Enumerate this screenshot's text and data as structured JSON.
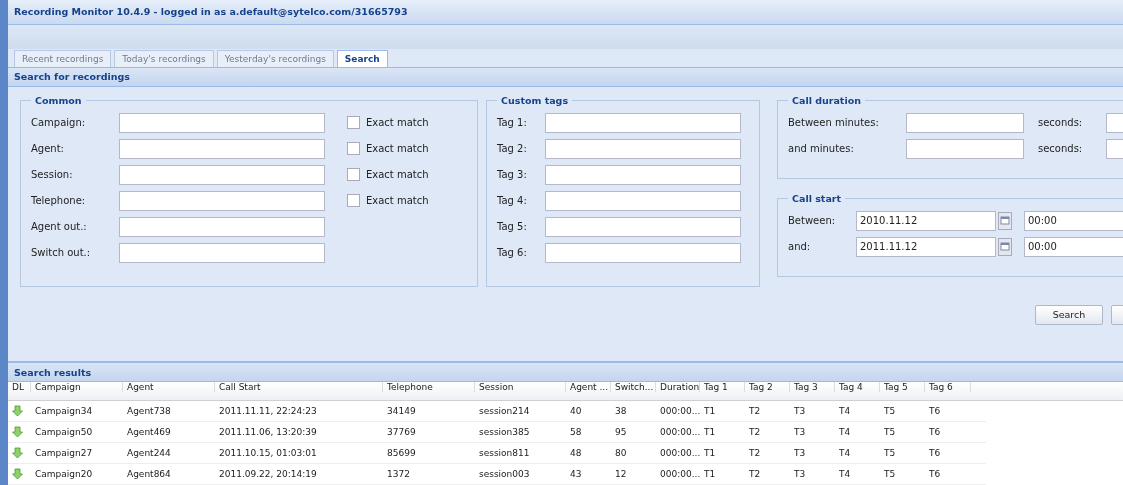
{
  "window": {
    "title": "Recording Monitor 10.4.9 - logged in as a.default@sytelco.com/31665793"
  },
  "tabs": [
    {
      "label": "Recent recordings",
      "selected": false
    },
    {
      "label": "Today's recordings",
      "selected": false
    },
    {
      "label": "Yesterday's recordings",
      "selected": false
    },
    {
      "label": "Search",
      "selected": true
    }
  ],
  "search_panel": {
    "title": "Search for recordings",
    "common": {
      "title": "Common",
      "fields": [
        {
          "label": "Campaign:",
          "exact_match": {
            "label": "Exact match",
            "checked": false
          }
        },
        {
          "label": "Agent:",
          "exact_match": {
            "label": "Exact match",
            "checked": false
          }
        },
        {
          "label": "Session:",
          "exact_match": {
            "label": "Exact match",
            "checked": false
          }
        },
        {
          "label": "Telephone:",
          "exact_match": {
            "label": "Exact match",
            "checked": false
          }
        },
        {
          "label": "Agent out.:"
        },
        {
          "label": "Switch out.:"
        }
      ]
    },
    "custom_tags": {
      "title": "Custom tags",
      "fields": [
        {
          "label": "Tag 1:"
        },
        {
          "label": "Tag 2:"
        },
        {
          "label": "Tag 3:"
        },
        {
          "label": "Tag 4:"
        },
        {
          "label": "Tag 5:"
        },
        {
          "label": "Tag 6:"
        }
      ]
    },
    "call_duration": {
      "title": "Call duration",
      "rows": [
        {
          "label": "Between minutes:",
          "seconds_label": "seconds:"
        },
        {
          "label": "and minutes:",
          "seconds_label": "seconds:"
        }
      ]
    },
    "call_start": {
      "title": "Call start",
      "rows": [
        {
          "label": "Between:",
          "date": "2010.11.12",
          "time": "00:00"
        },
        {
          "label": "and:",
          "date": "2011.11.12",
          "time": "00:00"
        }
      ]
    },
    "buttons": [
      "Search"
    ]
  },
  "results": {
    "title": "Search results",
    "columns": [
      "DL",
      "Campaign",
      "Agent",
      "Call Start",
      "Telephone",
      "Session",
      "Agent ...",
      "Switch...",
      "Duration",
      "Tag 1",
      "Tag 2",
      "Tag 3",
      "Tag 4",
      "Tag 5",
      "Tag 6"
    ],
    "rows": [
      [
        "",
        "Campaign34",
        "Agent738",
        "2011.11.11, 22:24:23",
        "34149",
        "session214",
        "40",
        "38",
        "000:00...",
        "T1",
        "T2",
        "T3",
        "T4",
        "T5",
        "T6"
      ],
      [
        "",
        "Campaign50",
        "Agent469",
        "2011.11.06, 13:20:39",
        "37769",
        "session385",
        "58",
        "95",
        "000:00...",
        "T1",
        "T2",
        "T3",
        "T4",
        "T5",
        "T6"
      ],
      [
        "",
        "Campaign27",
        "Agent244",
        "2011.10.15, 01:03:01",
        "85699",
        "session811",
        "48",
        "80",
        "000:00...",
        "T1",
        "T2",
        "T3",
        "T4",
        "T5",
        "T6"
      ],
      [
        "",
        "Campaign20",
        "Agent864",
        "2011.09.22, 20:14:19",
        "1372",
        "session003",
        "43",
        "12",
        "000:00...",
        "T1",
        "T2",
        "T3",
        "T4",
        "T5",
        "T6"
      ]
    ]
  }
}
